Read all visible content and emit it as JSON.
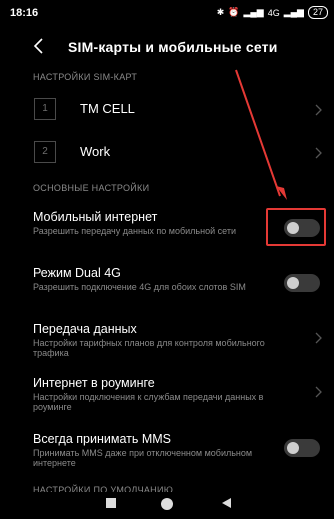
{
  "status": {
    "time": "18:16",
    "network": "4G",
    "battery": "27"
  },
  "header": {
    "title": "SIM-карты и мобильные сети"
  },
  "sim_section": {
    "heading": "НАСТРОЙКИ SIM-КАРТ",
    "sims": [
      {
        "slot": "1",
        "name": "TM CELL"
      },
      {
        "slot": "2",
        "name": "Work"
      }
    ]
  },
  "main_section": {
    "heading": "ОСНОВНЫЕ НАСТРОЙКИ",
    "items": [
      {
        "title": "Мобильный интернет",
        "subtitle": "Разрешить передачу данных по мобильной сети",
        "control": "toggle",
        "on": false
      },
      {
        "title": "Режим Dual 4G",
        "subtitle": "Разрешить подключение 4G для обоих слотов SIM",
        "control": "toggle",
        "on": false
      },
      {
        "title": "Передача данных",
        "subtitle": "Настройки тарифных планов для контроля мобильного трафика",
        "control": "chevron"
      },
      {
        "title": "Интернет в роуминге",
        "subtitle": "Настройки подключения к службам передачи данных в роуминге",
        "control": "chevron"
      },
      {
        "title": "Всегда принимать MMS",
        "subtitle": "Принимать MMS даже при отключенном мобильном интернете",
        "control": "toggle",
        "on": false
      }
    ]
  },
  "default_section": {
    "heading": "НАСТРОЙКИ ПО УМОЛЧАНИЮ"
  },
  "colors": {
    "background": "#000000",
    "annotation": "#e53935",
    "secondary_text": "#8a8a8a"
  },
  "icons": [
    "back-arrow-icon",
    "chevron-right-icon",
    "bluetooth-icon",
    "alarm-icon",
    "signal-icon",
    "battery-icon",
    "recents-icon",
    "home-icon",
    "back-nav-icon"
  ]
}
